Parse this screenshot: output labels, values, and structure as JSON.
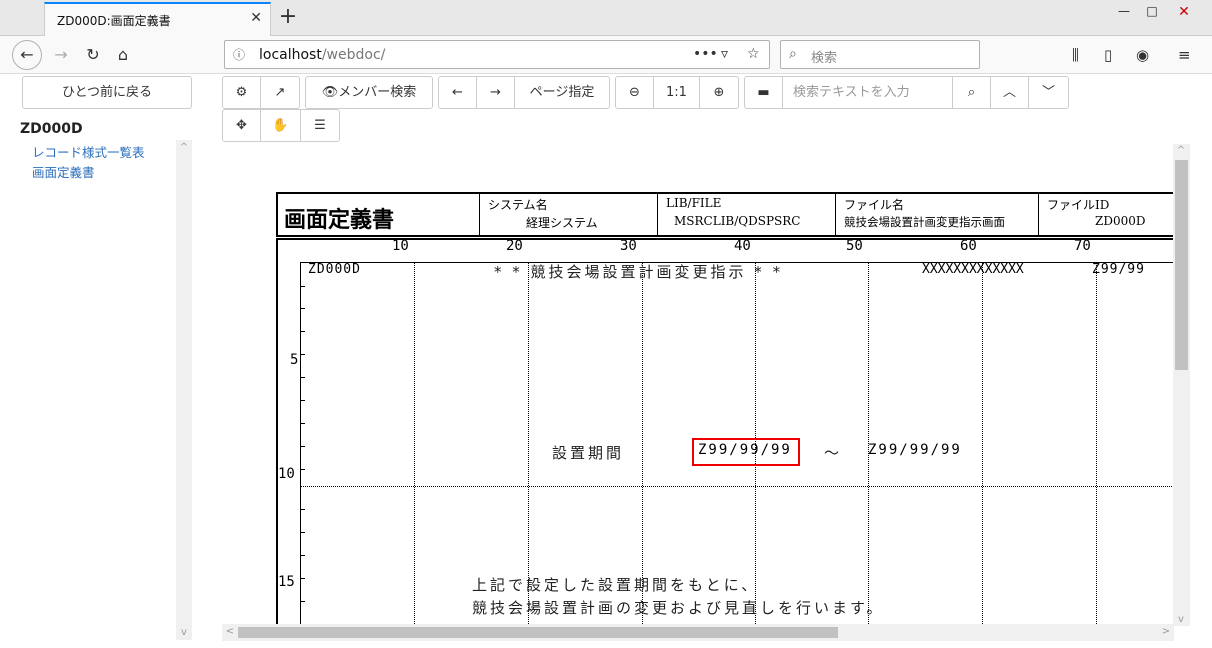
{
  "browser": {
    "tab_title": "ZD000D:画面定義書",
    "url_host": "localhost",
    "url_path": "/webdoc/",
    "search_placeholder": "検索"
  },
  "sidebar": {
    "back_label": "ひとつ前に戻る",
    "doc_id": "ZD000D",
    "items": [
      {
        "label": "レコード様式一覧表"
      },
      {
        "label": "画面定義書"
      }
    ]
  },
  "toolbar": {
    "member_search": "メンバー検索",
    "page_select": "ページ指定",
    "zoom_reset": "1:1",
    "search_placeholder": "検索テキストを入力"
  },
  "document": {
    "title": "画面定義書",
    "system_label": "システム名",
    "system_value": "経理システム",
    "lib_label": "LIB/FILE",
    "lib_value": "MSRCLIB/QDSPSRC",
    "file_label": "ファイル名",
    "file_value": "競技会場設置計画変更指示画面",
    "fileid_label": "ファイルID",
    "fileid_value": "ZD000D",
    "col_numbers": [
      "10",
      "20",
      "30",
      "40",
      "50",
      "60",
      "70"
    ],
    "row_numbers": [
      "5",
      "10",
      "15"
    ],
    "line1_id": "ZD000D",
    "line1_title": "* *  競技会場設置計画変更指示  * *",
    "line1_x": "XXXXXXXXXXXXX",
    "line1_date": "Z99/99",
    "period_label": "設置期間",
    "period_from": "Z99/99/99",
    "period_sep": "～",
    "period_to": "Z99/99/99",
    "note_line1": "上記で設定した設置期間をもとに、",
    "note_line2": "競技会場設置計画の変更および見直しを行います。"
  }
}
